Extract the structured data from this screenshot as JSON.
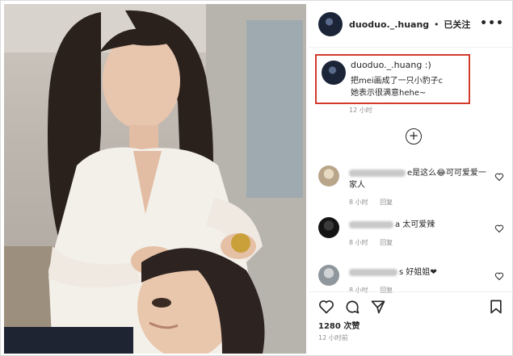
{
  "post": {
    "author": "duoduo._.huang",
    "follow_status": "已关注",
    "more_icon": "more-horizontal-icon",
    "caption": {
      "author": "duoduo._.huang :)",
      "line1": "把mei画成了一只小豹子c",
      "line2": "她表示很满意hehe~",
      "time": "12 小时"
    },
    "load_more_icon": "plus-circle-icon",
    "comments": [
      {
        "text_visible": "e是这么😂可可爱爱一家人",
        "time": "8 小时",
        "reply": "回复"
      },
      {
        "text_visible": "a 太可爱辣",
        "time": "8 小时",
        "reply": "回复"
      },
      {
        "text_visible": "s 好姐姐❤",
        "time": "8 小时",
        "reply": "回复"
      }
    ],
    "likes": "1280 次赞",
    "time": "12 小时前",
    "icons": [
      "heart-icon",
      "comment-icon",
      "share-icon",
      "bookmark-icon"
    ]
  },
  "colors": {
    "highlight_border": "#d33a2c",
    "secondary_text": "#8e8e8e"
  }
}
